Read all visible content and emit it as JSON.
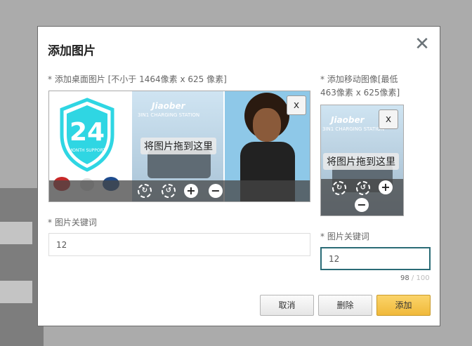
{
  "dialog": {
    "title": "添加图片",
    "close_glyph": "✕"
  },
  "desktop": {
    "label": "* 添加桌面图片 [不小于 1464像素 x 625 像素]",
    "drop_hint": "将图片拖到这里",
    "remove_label": "x",
    "banner": {
      "badge_number": "24",
      "badge_sub": "MONTH SUPPORT",
      "brand": "Jiaober",
      "station_text": "3IN1 CHARGING STATION"
    },
    "keyword_label": "* 图片关键词",
    "keyword_value": "12"
  },
  "mobile": {
    "label_line1": "* 添加移动图像[最低",
    "label_line2": "463像素 x 625像素]",
    "drop_hint": "将图片拖到这里",
    "remove_label": "x",
    "banner": {
      "brand": "Jiaober",
      "station_text": "3IN1 CHARGING STATION"
    },
    "keyword_label": "* 图片关键词",
    "keyword_value": "12",
    "counter_current": "98",
    "counter_max": "/ 100"
  },
  "tools": {
    "rotate_right": "↻",
    "rotate_left": "↺",
    "zoom_in": "+",
    "zoom_out": "−"
  },
  "footer": {
    "cancel": "取消",
    "delete": "删除",
    "add": "添加"
  },
  "colors": {
    "accent": "#f0b93a",
    "focus_border": "#2a6b76",
    "badge": "#2fd6e3"
  }
}
